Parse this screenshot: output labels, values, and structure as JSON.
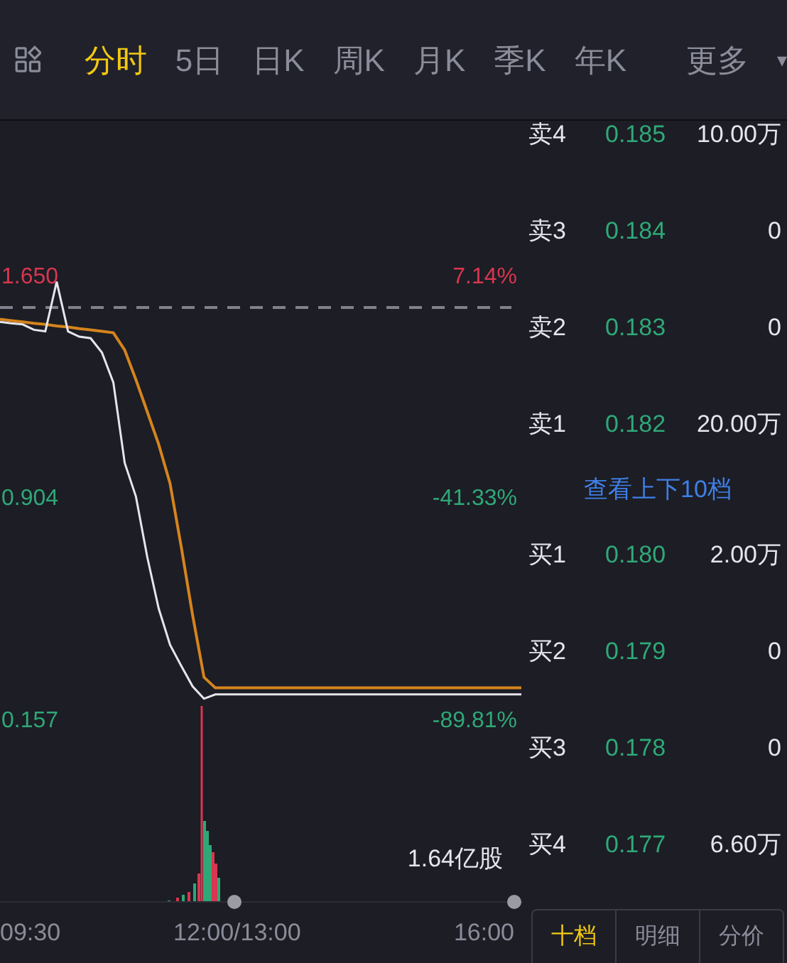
{
  "toolbar": {
    "tabs": [
      {
        "label": "分时",
        "selected": true
      },
      {
        "label": "5日",
        "selected": false
      },
      {
        "label": "日K",
        "selected": false
      },
      {
        "label": "周K",
        "selected": false
      },
      {
        "label": "月K",
        "selected": false
      },
      {
        "label": "季K",
        "selected": false
      },
      {
        "label": "年K",
        "selected": false
      },
      {
        "label": "更多",
        "selected": false
      }
    ],
    "dropdown": "▾"
  },
  "chart": {
    "chart_data": {
      "type": "line",
      "categories": [
        null,
        null,
        null,
        null,
        null,
        null,
        null,
        null,
        null,
        null,
        null,
        null,
        null,
        null,
        null,
        null,
        null,
        null,
        null,
        null,
        null,
        null,
        null,
        null,
        null,
        null,
        null,
        null,
        null,
        null,
        null,
        null,
        null,
        null,
        null,
        null,
        null,
        null,
        null,
        null,
        null,
        null,
        null,
        null,
        null,
        null,
        null
      ],
      "series": [
        {
          "color": "#e6e6ea",
          "values": [
            1.492,
            1.487,
            1.483,
            1.465,
            1.46,
            1.627,
            1.46,
            1.442,
            1.437,
            1.388,
            1.288,
            1.017,
            0.904,
            0.7,
            0.528,
            0.406,
            0.334,
            0.266,
            0.225,
            0.239,
            0.239,
            0.239,
            0.239,
            0.239,
            0.239,
            0.239,
            0.239,
            0.239,
            0.239,
            0.239,
            0.239,
            0.239,
            0.239,
            0.239,
            0.239,
            0.239,
            0.239,
            0.239,
            0.239,
            0.239,
            0.239,
            0.239,
            0.239,
            0.239,
            0.239,
            0.239,
            0.239
          ]
        },
        {
          "color": "#d5841d",
          "values": [
            1.501,
            1.496,
            1.492,
            1.487,
            1.483,
            1.478,
            1.474,
            1.469,
            1.465,
            1.46,
            1.455,
            1.397,
            1.297,
            1.189,
            1.08,
            0.949,
            0.732,
            0.505,
            0.297,
            0.261,
            0.261,
            0.261,
            0.261,
            0.261,
            0.261,
            0.261,
            0.261,
            0.261,
            0.261,
            0.261,
            0.261,
            0.261,
            0.261,
            0.261,
            0.261,
            0.261,
            0.261,
            0.261,
            0.261,
            0.261,
            0.261,
            0.261,
            0.261,
            0.261,
            0.261,
            0.261,
            0.261
          ]
        }
      ],
      "ylim": [
        -0.664,
        2.574
      ],
      "ref_lines": [
        {
          "axis": "y",
          "value": 1.54
        }
      ],
      "yticks": [
        {
          "value": 1.65,
          "label": "1.650"
        },
        {
          "value": 0.904,
          "label": "0.904"
        },
        {
          "value": 0.157,
          "label": "0.157"
        }
      ]
    },
    "percent_labels": [
      {
        "text": "7.14%",
        "color": "#d9364f"
      },
      {
        "text": "-41.33%",
        "color": "#2fa877"
      },
      {
        "text": "-89.81%",
        "color": "#2fa877"
      }
    ],
    "volume": "1.64亿股",
    "time_labels": [
      "09:30",
      "12:00/13:00",
      "16:00"
    ]
  },
  "order_book": {
    "rows": [
      {
        "kind": "level",
        "label": "卖4",
        "price": "0.185",
        "volume": "10.00万"
      },
      {
        "kind": "level",
        "label": "卖3",
        "price": "0.184",
        "volume": "0"
      },
      {
        "kind": "level",
        "label": "卖2",
        "price": "0.183",
        "volume": "0"
      },
      {
        "kind": "level",
        "label": "卖1",
        "price": "0.182",
        "volume": "20.00万"
      },
      {
        "kind": "link",
        "text": "查看上下10档"
      },
      {
        "kind": "level",
        "label": "买1",
        "price": "0.180",
        "volume": "2.00万"
      },
      {
        "kind": "level",
        "label": "买2",
        "price": "0.179",
        "volume": "0"
      },
      {
        "kind": "level",
        "label": "买3",
        "price": "0.178",
        "volume": "0"
      },
      {
        "kind": "level",
        "label": "买4",
        "price": "0.177",
        "volume": "6.60万"
      }
    ],
    "tabs": [
      {
        "label": "十档",
        "selected": true
      },
      {
        "label": "明细",
        "selected": false
      },
      {
        "label": "分价",
        "selected": false
      }
    ]
  }
}
